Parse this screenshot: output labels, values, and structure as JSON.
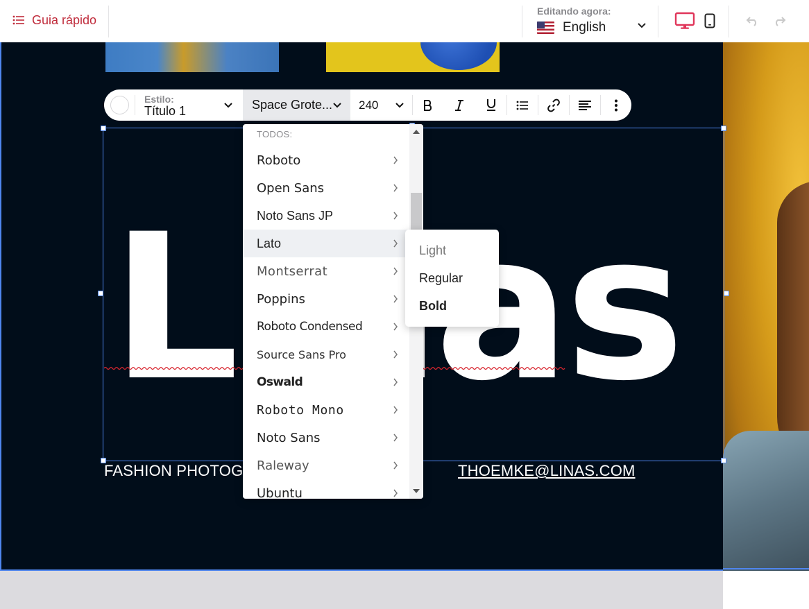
{
  "topbar": {
    "guide_label": "Guia rápido",
    "editing_label": "Editando agora:",
    "language": "English",
    "language_flag": "us-flag-icon",
    "accent_color": "#c02c3c",
    "active_device": "desktop"
  },
  "toolbar": {
    "style_label": "Estilo:",
    "style_value": "Título 1",
    "font_value": "Space Grote...",
    "size_value": "240"
  },
  "font_menu": {
    "header": "TODOS:",
    "items": [
      {
        "label": "Roboto"
      },
      {
        "label": "Open Sans"
      },
      {
        "label": "Noto Sans JP"
      },
      {
        "label": "Lato"
      },
      {
        "label": "Montserrat"
      },
      {
        "label": "Poppins"
      },
      {
        "label": "Roboto Condensed"
      },
      {
        "label": "Source Sans Pro"
      },
      {
        "label": "Oswald"
      },
      {
        "label": "Roboto Mono"
      },
      {
        "label": "Noto Sans"
      },
      {
        "label": "Raleway"
      },
      {
        "label": "Ubuntu"
      }
    ],
    "active_item": "Lato"
  },
  "weight_menu": {
    "items": [
      "Light",
      "Regular",
      "Bold"
    ]
  },
  "canvas": {
    "heading": "Linas",
    "footer_left": "FASHION PHOTOGRA",
    "footer_right": "THOEMKE@LINAS.COM",
    "background": "#010d1a",
    "selection_color": "#4f86ef"
  }
}
